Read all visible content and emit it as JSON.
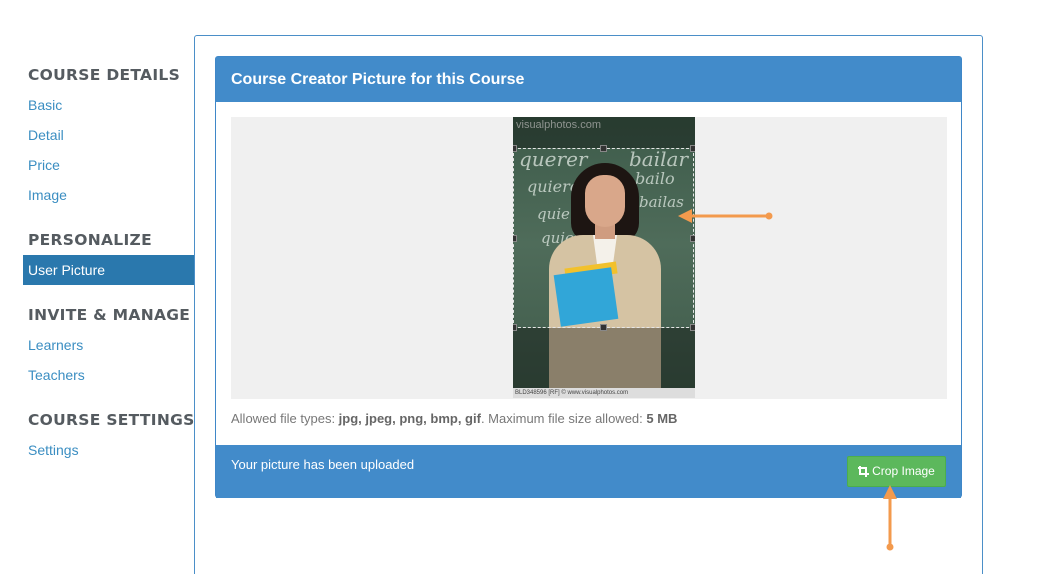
{
  "sidebar": {
    "sections": [
      {
        "title": "COURSE DETAILS",
        "items": [
          "Basic",
          "Detail",
          "Price",
          "Image"
        ]
      },
      {
        "title": "PERSONALIZE",
        "items": [
          "User Picture"
        ]
      },
      {
        "title": "INVITE & MANAGE",
        "items": [
          "Learners",
          "Teachers"
        ]
      },
      {
        "title": "COURSE SETTINGS",
        "items": [
          "Settings"
        ]
      }
    ],
    "active_item": "User Picture"
  },
  "card": {
    "title": "Course Creator Picture for this Course",
    "allowed_prefix": "Allowed file types: ",
    "allowed_types": "jpg, jpeg, png, bmp, gif",
    "max_size_text": ". Maximum file size allowed: ",
    "max_size": "5 MB",
    "status": "Your picture has been uploaded",
    "crop_button": "Crop Image"
  },
  "photo": {
    "watermark": "visualphotos.com",
    "caption": "BLD348596 [RF] © www.visualphotos.com",
    "chalk_words": [
      "querer",
      "bailar",
      "quiero",
      "bailo",
      "quiere",
      "bailas",
      "quier"
    ]
  },
  "colors": {
    "header_blue": "#428bca",
    "active_nav": "#2a78ad",
    "link_blue": "#3b8ec2",
    "button_green": "#5cb85c",
    "annotation_orange": "#f39a4d"
  }
}
